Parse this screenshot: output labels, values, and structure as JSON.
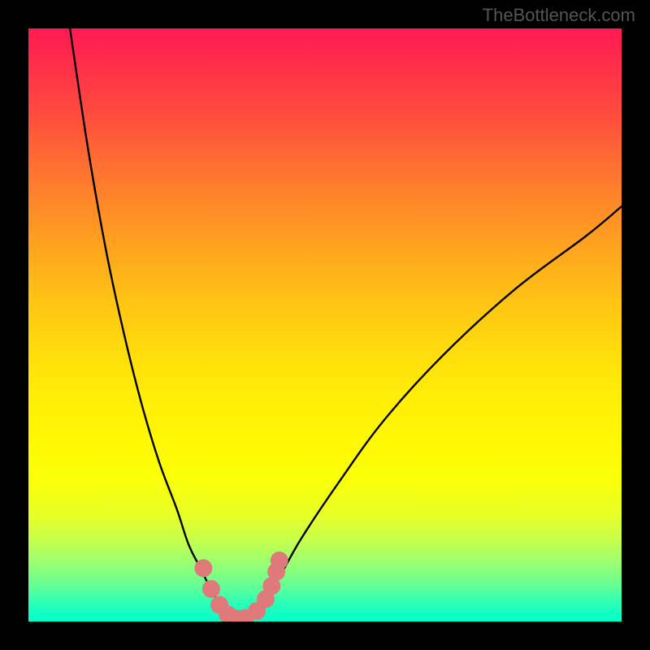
{
  "watermark": "TheBottleneck.com",
  "chart_data": {
    "type": "line",
    "title": "",
    "xlabel": "",
    "ylabel": "",
    "xlim": [
      0,
      100
    ],
    "ylim": [
      0,
      100
    ],
    "note": "Background is a vertical gradient from red (top, high) to green (bottom, low). The black curve is a V-shaped function with minimum near x≈35% reaching y≈0; left branch rises steeply to ~100 at x≈7; right branch rises with decreasing slope to ~70 at x=100. Pink dotted markers decorate the bottom of the V (roughly 30≤x≤42, y≤10).",
    "series": [
      {
        "name": "curve",
        "color": "#000000",
        "x": [
          7,
          10,
          13,
          16,
          19,
          22,
          25,
          27,
          29,
          31,
          33,
          35,
          37,
          39,
          42,
          46,
          52,
          60,
          70,
          82,
          94,
          100
        ],
        "y": [
          100,
          80,
          63,
          49,
          37,
          27,
          19,
          13,
          9,
          5,
          2,
          0.5,
          1,
          3,
          7,
          14,
          23,
          34,
          45,
          56,
          65,
          70
        ]
      }
    ],
    "markers": {
      "name": "dots",
      "color": "#e07a7a",
      "x": [
        29.5,
        30.8,
        32.2,
        33.6,
        35.0,
        36.5,
        38.5,
        40.0,
        41.0,
        41.8,
        42.3
      ],
      "y": [
        9.0,
        5.5,
        2.8,
        1.2,
        0.5,
        0.6,
        1.8,
        3.8,
        6.0,
        8.4,
        10.3
      ]
    }
  }
}
